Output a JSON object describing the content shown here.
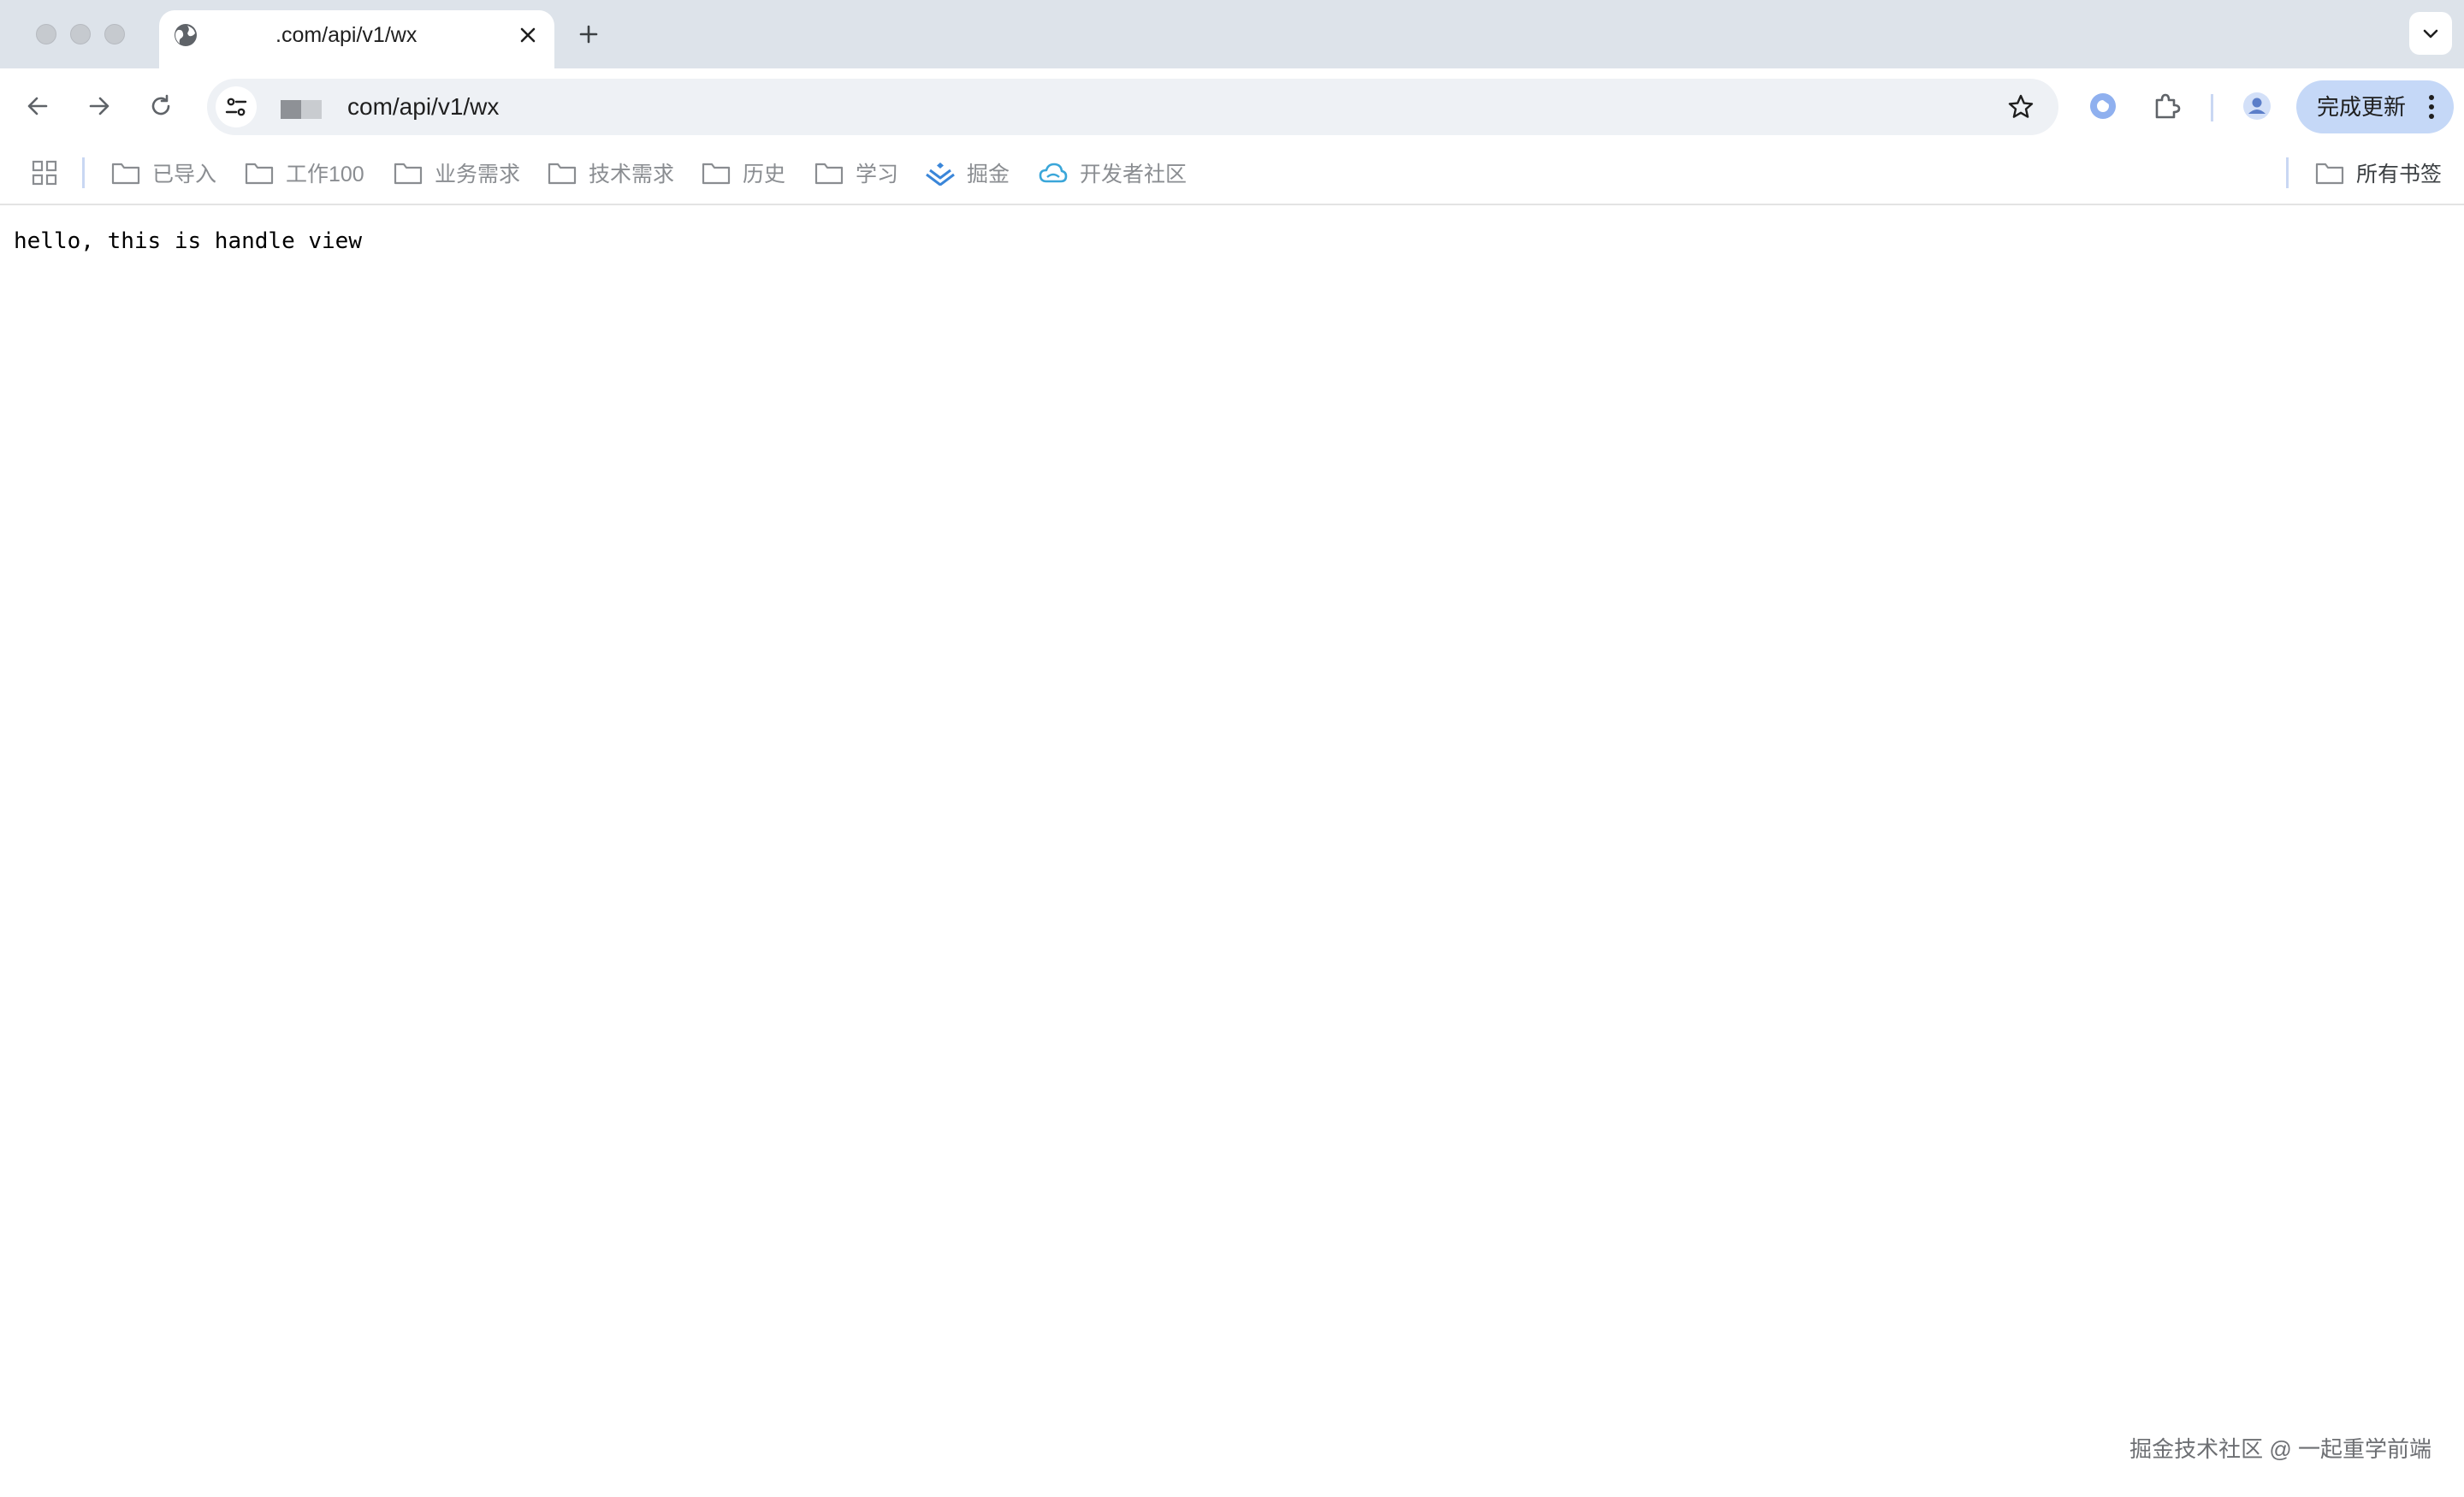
{
  "tab": {
    "title": ".com/api/v1/wx",
    "favicon": "globe-icon"
  },
  "toolbar": {
    "url": "com/api/v1/wx",
    "update_label": "完成更新",
    "accent": "#c5d8f7"
  },
  "bookmarks": [
    {
      "label": "已导入",
      "icon": "folder-icon"
    },
    {
      "label": "工作100",
      "icon": "folder-icon"
    },
    {
      "label": "业务需求",
      "icon": "folder-icon"
    },
    {
      "label": "技术需求",
      "icon": "folder-icon"
    },
    {
      "label": "历史",
      "icon": "folder-icon"
    },
    {
      "label": "学习",
      "icon": "folder-icon"
    },
    {
      "label": "掘金",
      "icon": "juejin-icon"
    },
    {
      "label": "开发者社区",
      "icon": "cloud-icon"
    }
  ],
  "all_bookmarks_label": "所有书签",
  "page": {
    "body_text": "hello, this is handle view"
  },
  "watermark": "掘金技术社区 @ 一起重学前端"
}
